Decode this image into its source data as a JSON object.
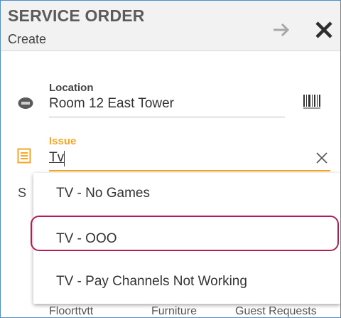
{
  "header": {
    "title": "SERVICE ORDER",
    "subtitle": "Create",
    "forward_icon": "arrow-right-icon",
    "close_icon": "close-icon"
  },
  "location": {
    "label": "Location",
    "value": "Room 12 East Tower",
    "icon": "building-icon",
    "scan_icon": "barcode-icon"
  },
  "issue": {
    "label": "Issue",
    "value": "Tv",
    "icon": "document-icon",
    "clear_icon": "clear-icon"
  },
  "partial_label": "S",
  "dropdown": {
    "options": [
      "TV - No Games",
      "TV - OOO",
      "TV - Pay Channels Not Working"
    ],
    "highlighted_index": 1
  },
  "bottom_tabs": [
    "Floorttvtt",
    "Furniture",
    "Guest Requests"
  ],
  "colors": {
    "accent": "#f5a623",
    "highlight_ring": "#b01e5a",
    "frame_border": "#4a90c9"
  }
}
